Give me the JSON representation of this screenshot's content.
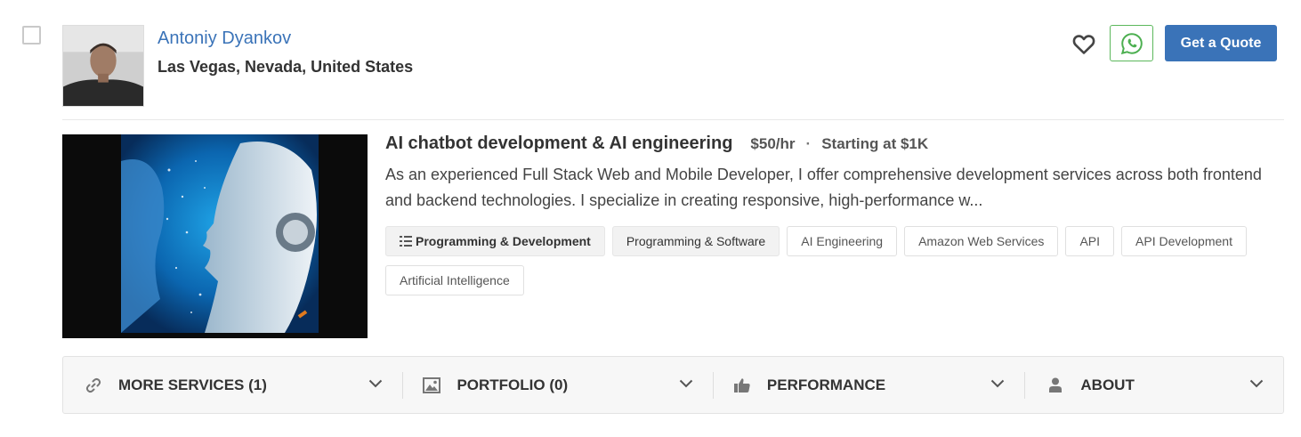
{
  "provider": {
    "name": "Antoniy Dyankov",
    "location": "Las Vegas, Nevada, United States"
  },
  "actions": {
    "quote_label": "Get a Quote",
    "favorite_icon": "heart-icon",
    "whatsapp_icon": "whatsapp-icon"
  },
  "service": {
    "title": "AI chatbot development & AI engineering",
    "rate": "$50/hr",
    "separator": "·",
    "starting": "Starting at $1K",
    "description": "As an experienced Full Stack Web and Mobile Developer, I offer comprehensive development services across both frontend and backend technologies. I specialize in creating responsive, high-performance w...",
    "tags": [
      "Programming & Development",
      "Programming & Software",
      "AI Engineering",
      "Amazon Web Services",
      "API",
      "API Development",
      "Artificial Intelligence"
    ]
  },
  "sections": [
    {
      "label": "MORE SERVICES (1)",
      "icon": "link-icon"
    },
    {
      "label": "PORTFOLIO (0)",
      "icon": "image-icon"
    },
    {
      "label": "PERFORMANCE",
      "icon": "thumbs-up-icon"
    },
    {
      "label": "ABOUT",
      "icon": "user-icon"
    }
  ],
  "colors": {
    "accent": "#3a73b8",
    "whatsapp": "#5cb85c"
  }
}
